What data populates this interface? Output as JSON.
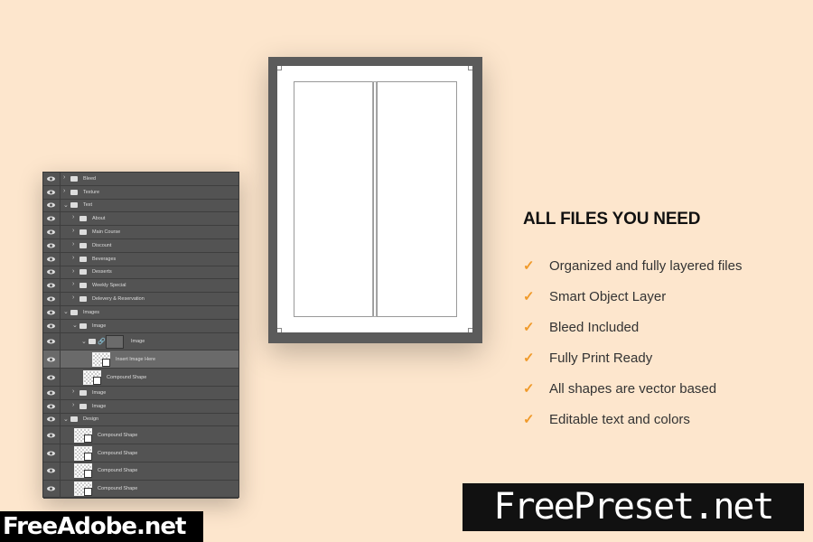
{
  "layers": [
    {
      "label": "Bleed",
      "indent": 0,
      "type": "folder",
      "expanded": false
    },
    {
      "label": "Texture",
      "indent": 0,
      "type": "folder",
      "expanded": false
    },
    {
      "label": "Text",
      "indent": 0,
      "type": "folder",
      "expanded": true
    },
    {
      "label": "About",
      "indent": 1,
      "type": "folder",
      "expanded": false
    },
    {
      "label": "Main Course",
      "indent": 1,
      "type": "folder",
      "expanded": false
    },
    {
      "label": "Discount",
      "indent": 1,
      "type": "folder",
      "expanded": false
    },
    {
      "label": "Beverages",
      "indent": 1,
      "type": "folder",
      "expanded": false
    },
    {
      "label": "Desserts",
      "indent": 1,
      "type": "folder",
      "expanded": false
    },
    {
      "label": "Weekly Special",
      "indent": 1,
      "type": "folder",
      "expanded": false
    },
    {
      "label": "Delevery & Reservation",
      "indent": 1,
      "type": "folder",
      "expanded": false
    },
    {
      "label": "Images",
      "indent": 0,
      "type": "folder",
      "expanded": true
    },
    {
      "label": "Image",
      "indent": 1,
      "type": "folder",
      "expanded": true
    },
    {
      "label": "Image",
      "indent": 2,
      "type": "masked-folder",
      "expanded": true
    },
    {
      "label": "Insert Image Here",
      "indent": 3,
      "type": "smart-object",
      "selected": true
    },
    {
      "label": "Compound Shape",
      "indent": 2,
      "type": "shape"
    },
    {
      "label": "Image",
      "indent": 1,
      "type": "folder",
      "expanded": false
    },
    {
      "label": "Image",
      "indent": 1,
      "type": "folder",
      "expanded": false
    },
    {
      "label": "Design",
      "indent": 0,
      "type": "folder",
      "expanded": true
    },
    {
      "label": "Compound Shape",
      "indent": 1,
      "type": "shape"
    },
    {
      "label": "Compound Shape",
      "indent": 1,
      "type": "shape"
    },
    {
      "label": "Compound Shape",
      "indent": 1,
      "type": "shape"
    },
    {
      "label": "Compound Shape",
      "indent": 1,
      "type": "shape"
    }
  ],
  "features": {
    "title": "ALL FILES YOU NEED",
    "items": [
      "Organized and fully layered files",
      "Smart Object Layer",
      "Bleed Included",
      "Fully Print Ready",
      "All shapes are vector based",
      "Editable text and colors"
    ],
    "check_color": "#f09a2a"
  },
  "watermarks": {
    "left": "FreeAdobe.net",
    "right": "FreePreset.net"
  }
}
